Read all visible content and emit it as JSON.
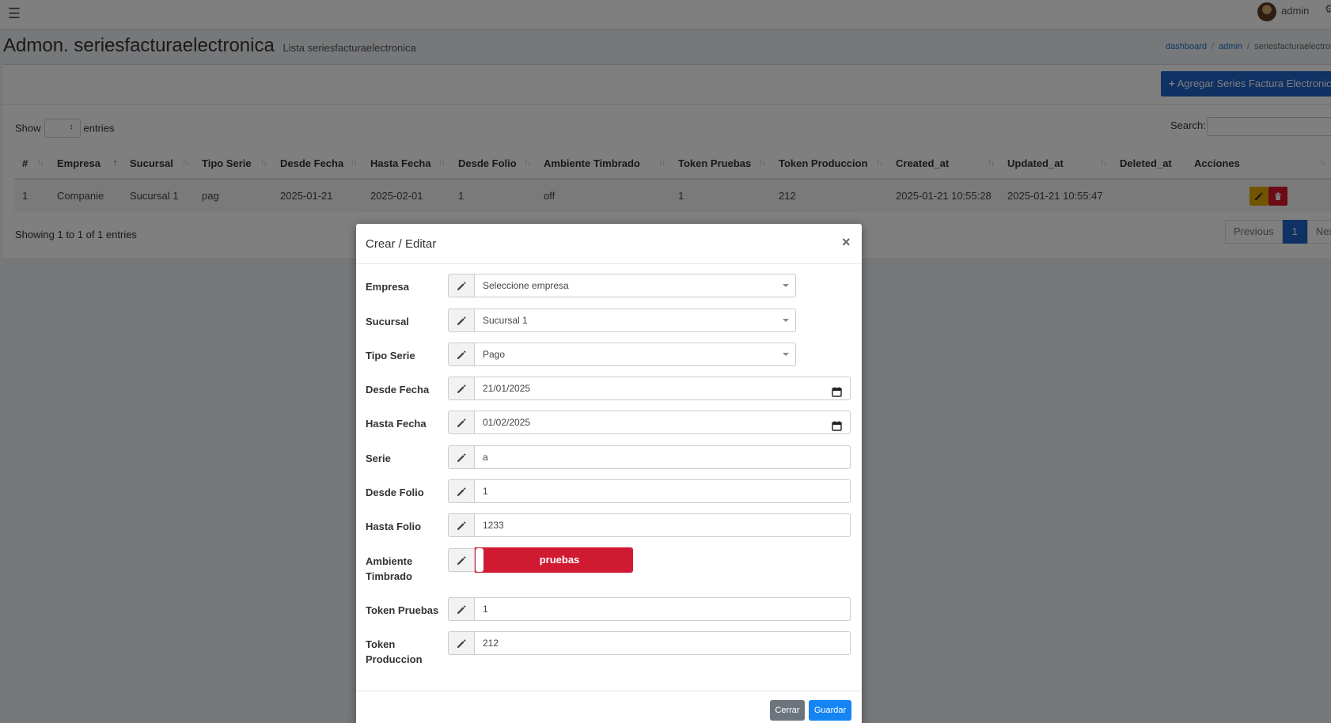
{
  "topbar": {
    "user_name": "admin"
  },
  "header": {
    "title": "Admon. seriesfacturaelectronica",
    "subtitle": "Lista seriesfacturaelectronica",
    "breadcrumb": [
      "dashboard",
      "admin",
      "seriesfacturaelectronica"
    ]
  },
  "toolbar": {
    "add_label": "Agregar Series Factura Electronica",
    "add_plus": "+"
  },
  "datatable": {
    "show_label": "Show",
    "entries_label": "entries",
    "search_label": "Search:",
    "columns": [
      "#",
      "Empresa",
      "Sucursal",
      "Tipo Serie",
      "Desde Fecha",
      "Hasta Fecha",
      "Desde Folio",
      "Ambiente Timbrado",
      "Token Pruebas",
      "Token Produccion",
      "Created_at",
      "Updated_at",
      "Deleted_at",
      "Acciones"
    ],
    "rows": [
      [
        "1",
        "Companie",
        "Sucursal 1",
        "pag",
        "2025-01-21",
        "2025-02-01",
        "1",
        "off",
        "1",
        "212",
        "2025-01-21 10:55:28",
        "2025-01-21 10:55:47",
        ""
      ]
    ],
    "info": "Showing 1 to 1 of 1 entries",
    "pagination": {
      "previous": "Previous",
      "current": "1",
      "next": "Next"
    }
  },
  "modal": {
    "title": "Crear / Editar",
    "close": "×",
    "fields": {
      "empresa": {
        "label": "Empresa",
        "value": "Seleccione empresa"
      },
      "sucursal": {
        "label": "Sucursal",
        "value": "Sucursal 1"
      },
      "tipo_serie": {
        "label": "Tipo Serie",
        "value": "Pago"
      },
      "desde_fecha": {
        "label": "Desde Fecha",
        "value": "21/01/2025"
      },
      "hasta_fecha": {
        "label": "Hasta Fecha",
        "value": "01/02/2025"
      },
      "serie": {
        "label": "Serie",
        "value": "a"
      },
      "desde_folio": {
        "label": "Desde Folio",
        "value": "1"
      },
      "hasta_folio": {
        "label": "Hasta Folio",
        "value": "1233"
      },
      "ambiente_timbrado": {
        "label": "Ambiente Timbrado",
        "value": "pruebas"
      },
      "token_pruebas": {
        "label": "Token Pruebas",
        "value": "1"
      },
      "token_produccion": {
        "label": "Token Produccion",
        "value": "212"
      }
    },
    "buttons": {
      "cerrar": "Cerrar",
      "guardar": "Guardar"
    }
  },
  "colors": {
    "primary": "#1e63c7",
    "danger": "#d01a32",
    "warning": "#e0a800",
    "secondary": "#6c757d"
  },
  "icons": [
    "menu-icon",
    "pencil-icon",
    "calendar-icon",
    "edit-icon",
    "trash-icon",
    "close-icon",
    "plus-icon"
  ]
}
